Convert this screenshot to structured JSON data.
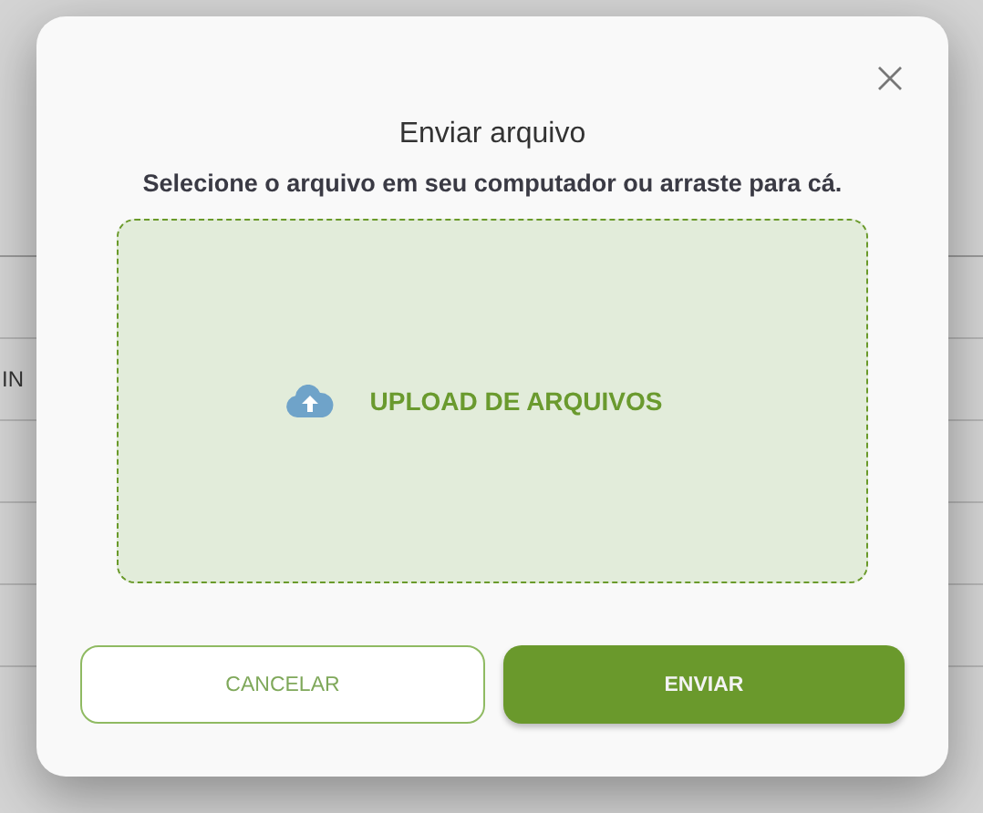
{
  "background_page": {
    "table_cell_text": "IN"
  },
  "dialog": {
    "title": "Enviar arquivo",
    "instruction": "Selecione o arquivo em seu computador ou arraste para cá.",
    "dropzone": {
      "label": "UPLOAD DE ARQUIVOS"
    },
    "buttons": [
      {
        "label": "CANCELAR",
        "kind": "secondary"
      },
      {
        "label": "ENVIAR",
        "kind": "primary"
      }
    ]
  }
}
